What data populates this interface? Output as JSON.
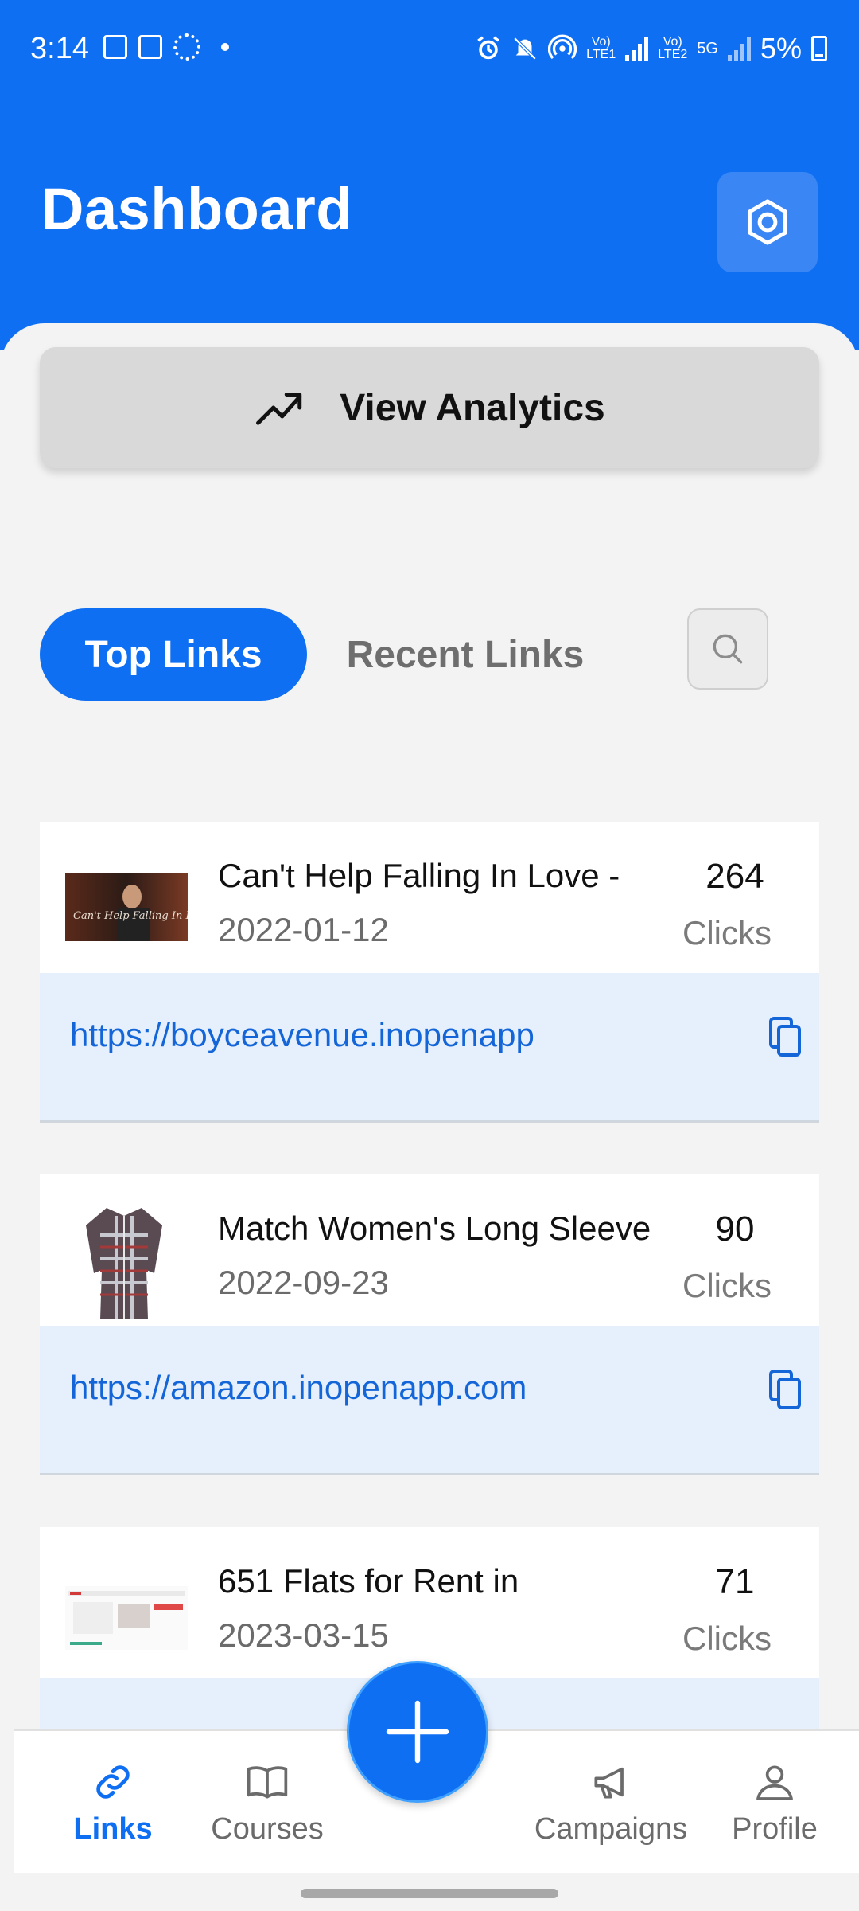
{
  "status_bar": {
    "time": "3:14",
    "battery": "5%",
    "lte1": "Vo)\nLTE1",
    "lte2": "Vo)\nLTE2",
    "net5g": "5G"
  },
  "header": {
    "title": "Dashboard"
  },
  "analytics": {
    "label": "View Analytics"
  },
  "tabs": {
    "active": "Top Links",
    "inactive": "Recent Links"
  },
  "links": [
    {
      "title": "Can't Help Falling In Love -",
      "date": "2022-01-12",
      "count": "264",
      "unit": "Clicks",
      "url": "https://boyceavenue.inopenapp",
      "thumb_text": "Can't Help Falling In Love"
    },
    {
      "title": "Match Women's Long Sleeve",
      "date": "2022-09-23",
      "count": "90",
      "unit": "Clicks",
      "url": "https://amazon.inopenapp.com"
    },
    {
      "title": "651   Flats for Rent in",
      "date": "2023-03-15",
      "count": "71",
      "unit": "Clicks",
      "url": ""
    }
  ],
  "nav": {
    "links": "Links",
    "courses": "Courses",
    "campaigns": "Campaigns",
    "profile": "Profile"
  },
  "colors": {
    "primary": "#0f6ff3",
    "link_bg": "#e6f0fd",
    "link_text": "#1466d8"
  }
}
